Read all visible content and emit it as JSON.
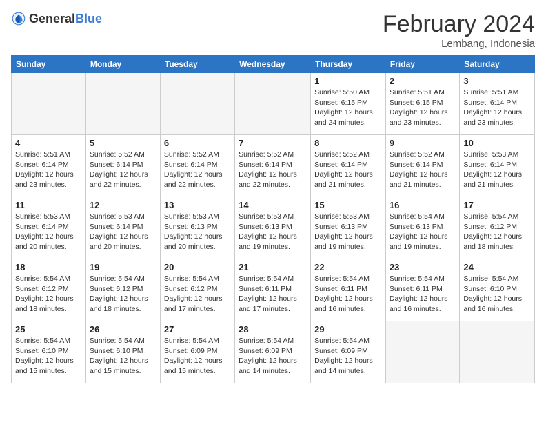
{
  "header": {
    "logo_general": "General",
    "logo_blue": "Blue",
    "month_title": "February 2024",
    "location": "Lembang, Indonesia"
  },
  "days_of_week": [
    "Sunday",
    "Monday",
    "Tuesday",
    "Wednesday",
    "Thursday",
    "Friday",
    "Saturday"
  ],
  "weeks": [
    [
      {
        "day": "",
        "info": ""
      },
      {
        "day": "",
        "info": ""
      },
      {
        "day": "",
        "info": ""
      },
      {
        "day": "",
        "info": ""
      },
      {
        "day": "1",
        "info": "Sunrise: 5:50 AM\nSunset: 6:15 PM\nDaylight: 12 hours\nand 24 minutes."
      },
      {
        "day": "2",
        "info": "Sunrise: 5:51 AM\nSunset: 6:15 PM\nDaylight: 12 hours\nand 23 minutes."
      },
      {
        "day": "3",
        "info": "Sunrise: 5:51 AM\nSunset: 6:14 PM\nDaylight: 12 hours\nand 23 minutes."
      }
    ],
    [
      {
        "day": "4",
        "info": "Sunrise: 5:51 AM\nSunset: 6:14 PM\nDaylight: 12 hours\nand 23 minutes."
      },
      {
        "day": "5",
        "info": "Sunrise: 5:52 AM\nSunset: 6:14 PM\nDaylight: 12 hours\nand 22 minutes."
      },
      {
        "day": "6",
        "info": "Sunrise: 5:52 AM\nSunset: 6:14 PM\nDaylight: 12 hours\nand 22 minutes."
      },
      {
        "day": "7",
        "info": "Sunrise: 5:52 AM\nSunset: 6:14 PM\nDaylight: 12 hours\nand 22 minutes."
      },
      {
        "day": "8",
        "info": "Sunrise: 5:52 AM\nSunset: 6:14 PM\nDaylight: 12 hours\nand 21 minutes."
      },
      {
        "day": "9",
        "info": "Sunrise: 5:52 AM\nSunset: 6:14 PM\nDaylight: 12 hours\nand 21 minutes."
      },
      {
        "day": "10",
        "info": "Sunrise: 5:53 AM\nSunset: 6:14 PM\nDaylight: 12 hours\nand 21 minutes."
      }
    ],
    [
      {
        "day": "11",
        "info": "Sunrise: 5:53 AM\nSunset: 6:14 PM\nDaylight: 12 hours\nand 20 minutes."
      },
      {
        "day": "12",
        "info": "Sunrise: 5:53 AM\nSunset: 6:14 PM\nDaylight: 12 hours\nand 20 minutes."
      },
      {
        "day": "13",
        "info": "Sunrise: 5:53 AM\nSunset: 6:13 PM\nDaylight: 12 hours\nand 20 minutes."
      },
      {
        "day": "14",
        "info": "Sunrise: 5:53 AM\nSunset: 6:13 PM\nDaylight: 12 hours\nand 19 minutes."
      },
      {
        "day": "15",
        "info": "Sunrise: 5:53 AM\nSunset: 6:13 PM\nDaylight: 12 hours\nand 19 minutes."
      },
      {
        "day": "16",
        "info": "Sunrise: 5:54 AM\nSunset: 6:13 PM\nDaylight: 12 hours\nand 19 minutes."
      },
      {
        "day": "17",
        "info": "Sunrise: 5:54 AM\nSunset: 6:12 PM\nDaylight: 12 hours\nand 18 minutes."
      }
    ],
    [
      {
        "day": "18",
        "info": "Sunrise: 5:54 AM\nSunset: 6:12 PM\nDaylight: 12 hours\nand 18 minutes."
      },
      {
        "day": "19",
        "info": "Sunrise: 5:54 AM\nSunset: 6:12 PM\nDaylight: 12 hours\nand 18 minutes."
      },
      {
        "day": "20",
        "info": "Sunrise: 5:54 AM\nSunset: 6:12 PM\nDaylight: 12 hours\nand 17 minutes."
      },
      {
        "day": "21",
        "info": "Sunrise: 5:54 AM\nSunset: 6:11 PM\nDaylight: 12 hours\nand 17 minutes."
      },
      {
        "day": "22",
        "info": "Sunrise: 5:54 AM\nSunset: 6:11 PM\nDaylight: 12 hours\nand 16 minutes."
      },
      {
        "day": "23",
        "info": "Sunrise: 5:54 AM\nSunset: 6:11 PM\nDaylight: 12 hours\nand 16 minutes."
      },
      {
        "day": "24",
        "info": "Sunrise: 5:54 AM\nSunset: 6:10 PM\nDaylight: 12 hours\nand 16 minutes."
      }
    ],
    [
      {
        "day": "25",
        "info": "Sunrise: 5:54 AM\nSunset: 6:10 PM\nDaylight: 12 hours\nand 15 minutes."
      },
      {
        "day": "26",
        "info": "Sunrise: 5:54 AM\nSunset: 6:10 PM\nDaylight: 12 hours\nand 15 minutes."
      },
      {
        "day": "27",
        "info": "Sunrise: 5:54 AM\nSunset: 6:09 PM\nDaylight: 12 hours\nand 15 minutes."
      },
      {
        "day": "28",
        "info": "Sunrise: 5:54 AM\nSunset: 6:09 PM\nDaylight: 12 hours\nand 14 minutes."
      },
      {
        "day": "29",
        "info": "Sunrise: 5:54 AM\nSunset: 6:09 PM\nDaylight: 12 hours\nand 14 minutes."
      },
      {
        "day": "",
        "info": ""
      },
      {
        "day": "",
        "info": ""
      }
    ]
  ]
}
